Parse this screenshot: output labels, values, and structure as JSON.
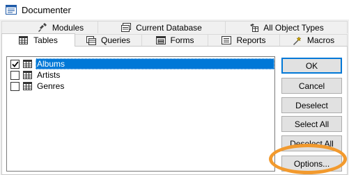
{
  "window": {
    "title": "Documenter",
    "icon": "documenter-icon"
  },
  "tabs_back_row": [
    {
      "label": "Modules",
      "icon": "modules-icon"
    },
    {
      "label": "Current Database",
      "icon": "database-icon"
    },
    {
      "label": "All Object Types",
      "icon": "all-objects-icon"
    }
  ],
  "tabs_front_row": [
    {
      "label": "Tables",
      "icon": "table-icon",
      "active": true
    },
    {
      "label": "Queries",
      "icon": "query-icon"
    },
    {
      "label": "Forms",
      "icon": "form-icon"
    },
    {
      "label": "Reports",
      "icon": "report-icon"
    },
    {
      "label": "Macros",
      "icon": "macro-icon"
    }
  ],
  "table_list": [
    {
      "label": "Albums",
      "checked": true,
      "selected": true
    },
    {
      "label": "Artists",
      "checked": false,
      "selected": false
    },
    {
      "label": "Genres",
      "checked": false,
      "selected": false
    }
  ],
  "buttons": {
    "ok": "OK",
    "cancel": "Cancel",
    "deselect": "Deselect",
    "select_all": "Select All",
    "deselect_all": "Deselect All",
    "options": "Options..."
  },
  "colors": {
    "selection": "#0078d7",
    "highlight_ring": "#f29a2e",
    "dialog_bg": "#f0f0f0"
  }
}
